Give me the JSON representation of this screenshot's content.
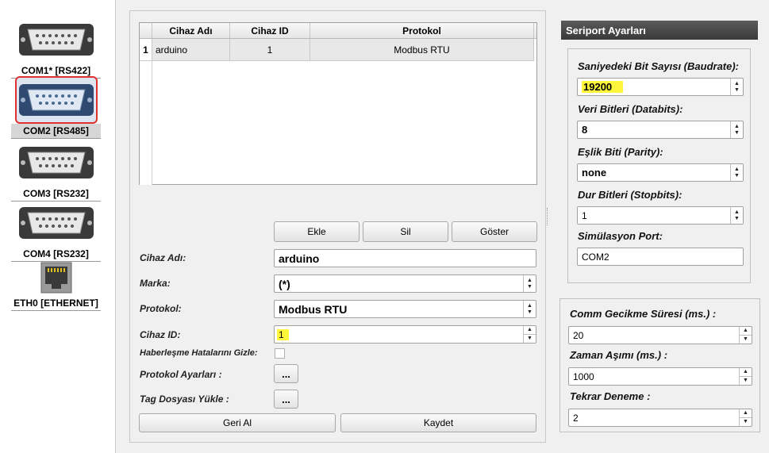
{
  "ports": [
    {
      "label": "COM1* [RS422]",
      "icon": "serial-port-icon",
      "selected": false
    },
    {
      "label": "COM2 [RS485]",
      "icon": "serial-port-icon",
      "selected": true
    },
    {
      "label": "COM3 [RS232]",
      "icon": "serial-port-icon",
      "selected": false
    },
    {
      "label": "COM4 [RS232]",
      "icon": "serial-port-icon",
      "selected": false
    },
    {
      "label": "ETH0 [ETHERNET]",
      "icon": "ethernet-port-icon",
      "selected": false
    }
  ],
  "table": {
    "headers": [
      "Cihaz Adı",
      "Cihaz ID",
      "Protokol"
    ],
    "rows": [
      {
        "num": "1",
        "name": "arduino",
        "id": "1",
        "protocol": "Modbus RTU"
      }
    ]
  },
  "buttons": {
    "add": "Ekle",
    "delete": "Sil",
    "show": "Göster",
    "undo": "Geri Al",
    "save": "Kaydet",
    "ellipsis": "..."
  },
  "form": {
    "device_name_label": "Cihaz Adı:",
    "device_name_value": "arduino",
    "brand_label": "Marka:",
    "brand_value": "(*)",
    "protocol_label": "Protokol:",
    "protocol_value": "Modbus RTU",
    "device_id_label": "Cihaz ID:",
    "device_id_value": "1",
    "hide_errors_label": "Haberleşme Hatalarını Gizle:",
    "hide_errors_checked": false,
    "protocol_settings_label": "Protokol Ayarları :",
    "tag_file_label": "Tag Dosyası Yükle :"
  },
  "serial": {
    "title": "Seriport Ayarları",
    "baud_label": "Saniyedeki Bit Sayısı (Baudrate):",
    "baud_value": "19200",
    "databits_label": "Veri Bitleri (Databits):",
    "databits_value": "8",
    "parity_label": "Eşlik Biti (Parity):",
    "parity_value": "none",
    "stopbits_label": "Dur Bitleri (Stopbits):",
    "stopbits_value": "1",
    "sim_port_label": "Simülasyon Port:",
    "sim_port_value": "COM2"
  },
  "comm": {
    "delay_label": "Comm Gecikme Süresi (ms.) :",
    "delay_value": "20",
    "timeout_label": "Zaman Aşımı (ms.) :",
    "timeout_value": "1000",
    "retry_label": "Tekrar Deneme :",
    "retry_value": "2"
  },
  "colors": {
    "highlight": "#fdf63a",
    "selected_border": "#e03030",
    "title_bar": "#4a4a4a"
  }
}
